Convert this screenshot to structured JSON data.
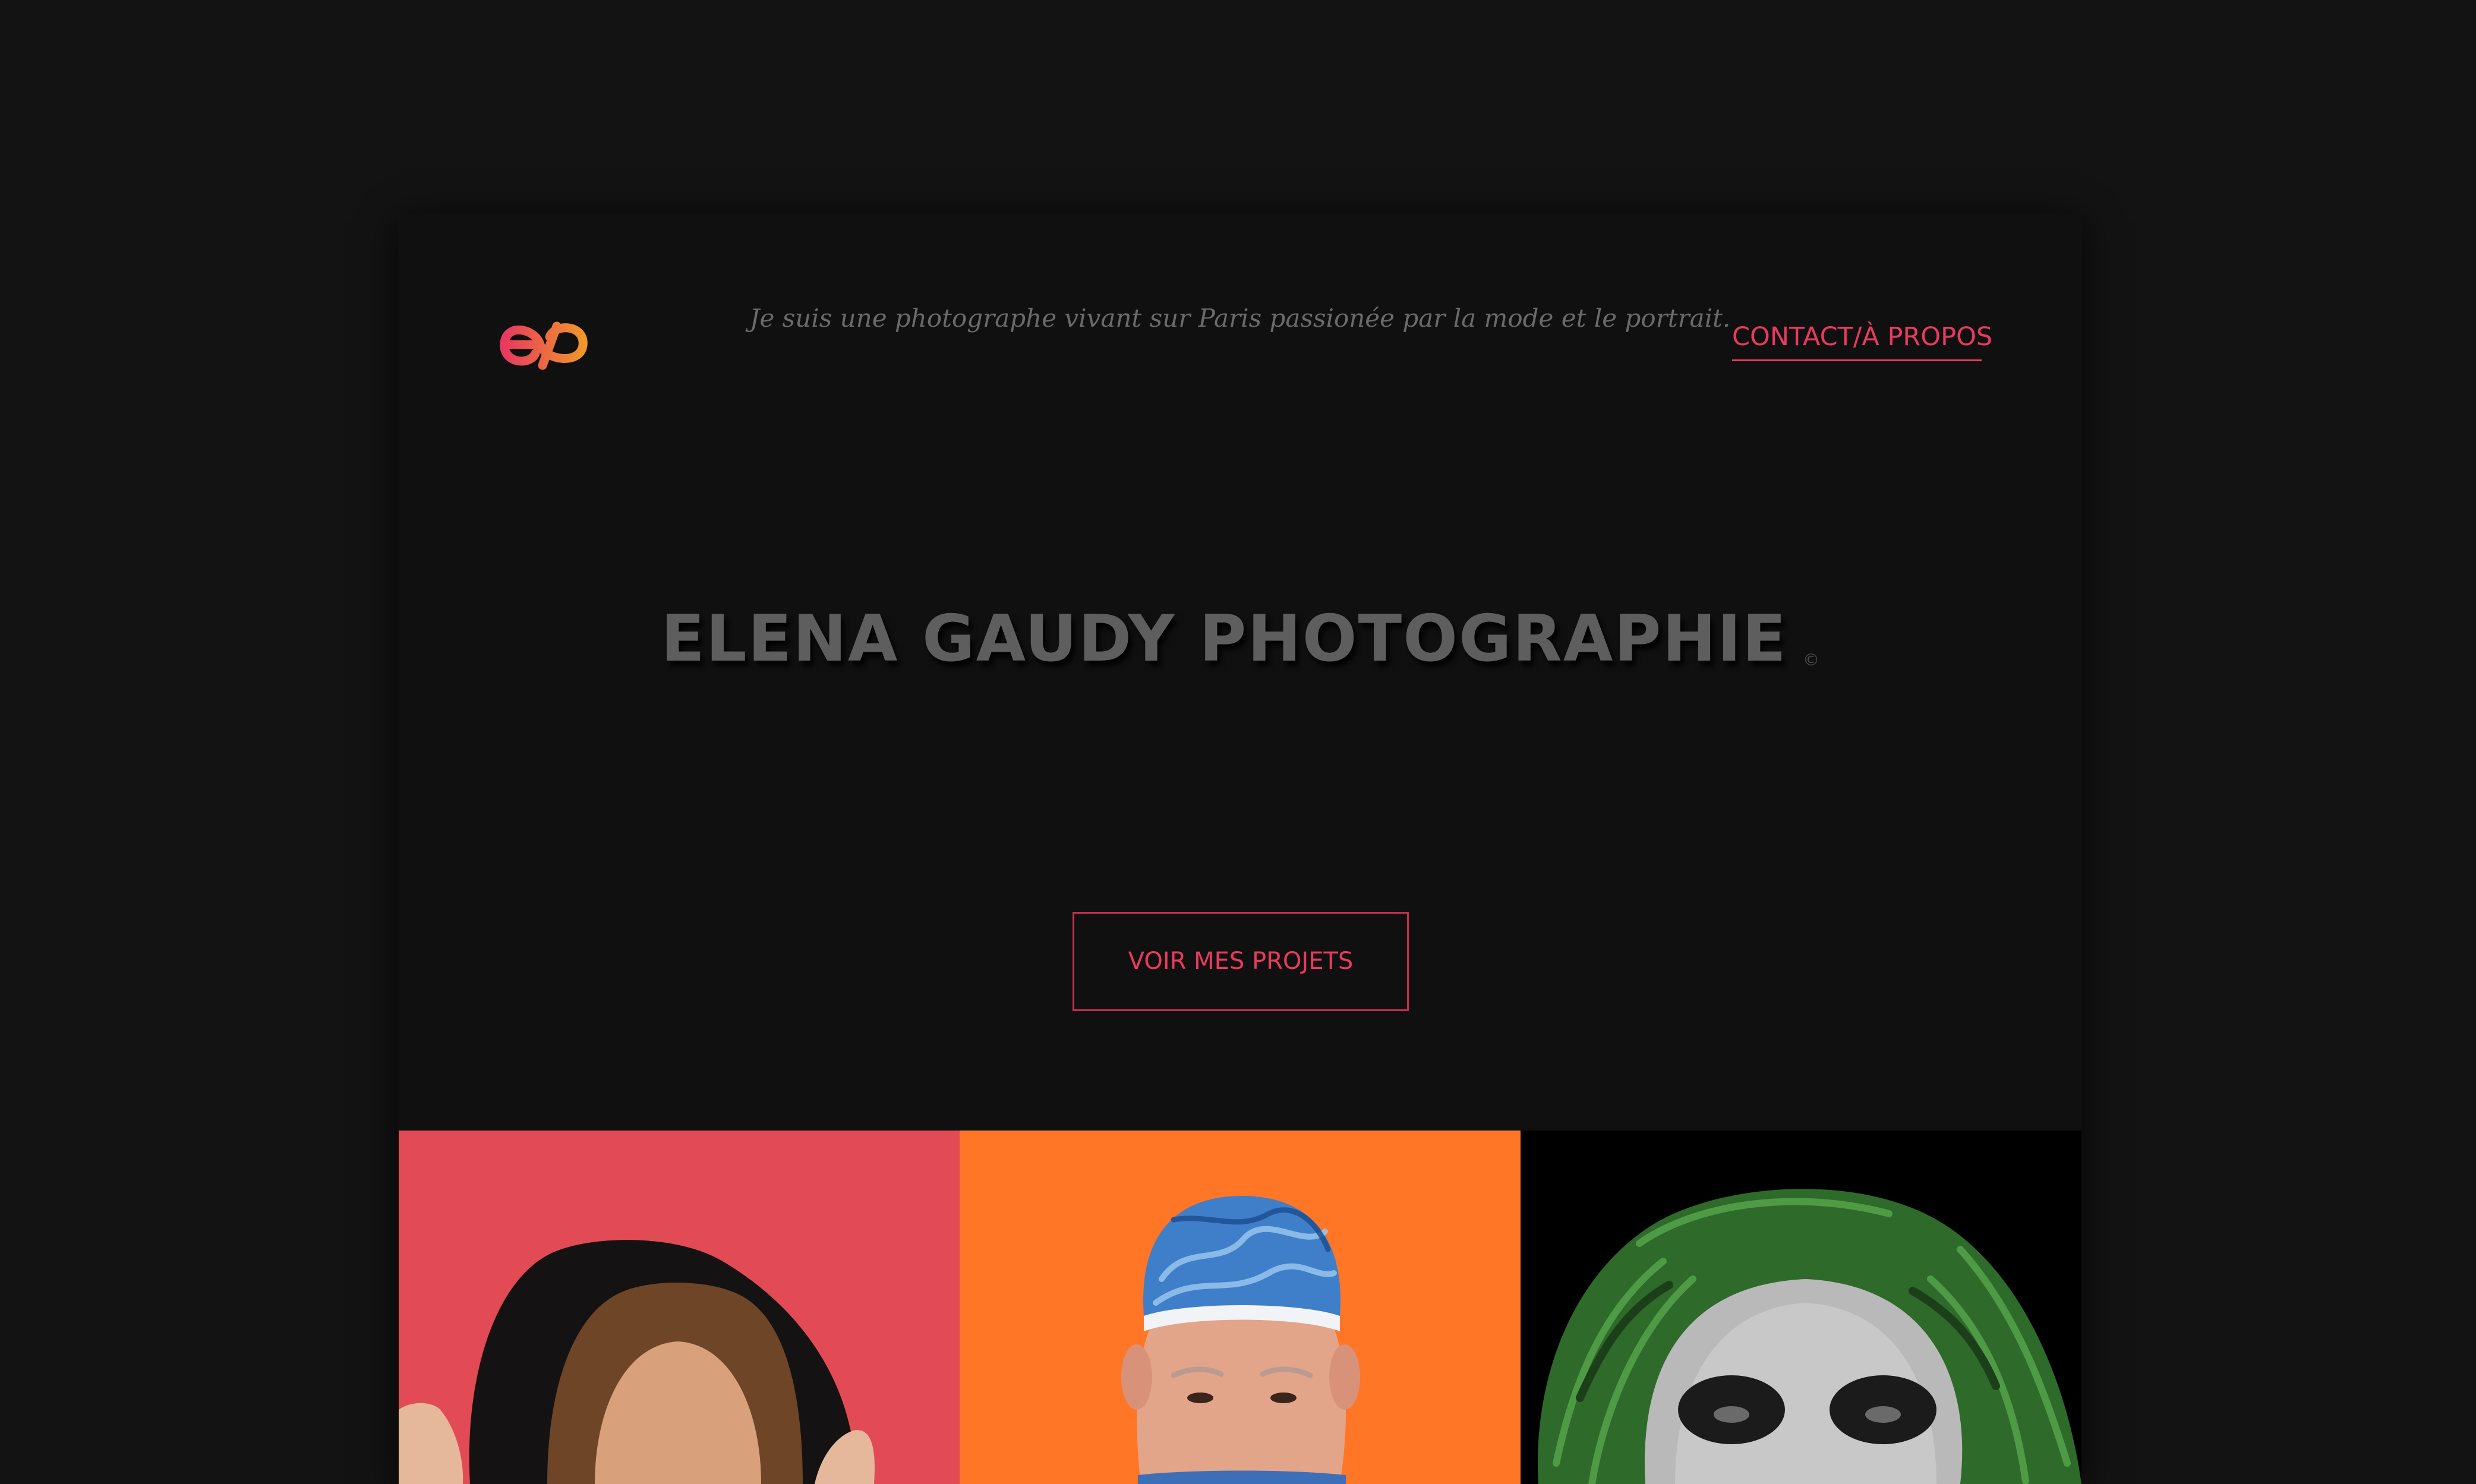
{
  "header": {
    "logo_name": "eg-infinity-logo",
    "nav_link": "CONTACT/À PROPOS"
  },
  "hero": {
    "title": "ELENA GAUDY PHOTOGRAPHIE",
    "copyright_mark": "©",
    "subtitle": "Je suis une photographe vivant sur Paris passionée par la mode et le portrait.",
    "cta_label": "VOIR MES PROJETS"
  },
  "gallery": {
    "tiles": [
      {
        "background": "#e24b55",
        "subject": "woman-hood-portrait"
      },
      {
        "background": "#ff7626",
        "subject": "surgeon-cap-portrait"
      },
      {
        "background": "#000000",
        "subject": "green-hair-facepaint-portrait"
      }
    ]
  },
  "colors": {
    "page_bg": "#131313",
    "panel_bg": "#101010",
    "accent": "#ea3a5f",
    "logo_gradient_start": "#e8395f",
    "logo_gradient_end": "#f0962a",
    "title": "#5e5e5e",
    "subtitle": "#6a6a6a"
  }
}
